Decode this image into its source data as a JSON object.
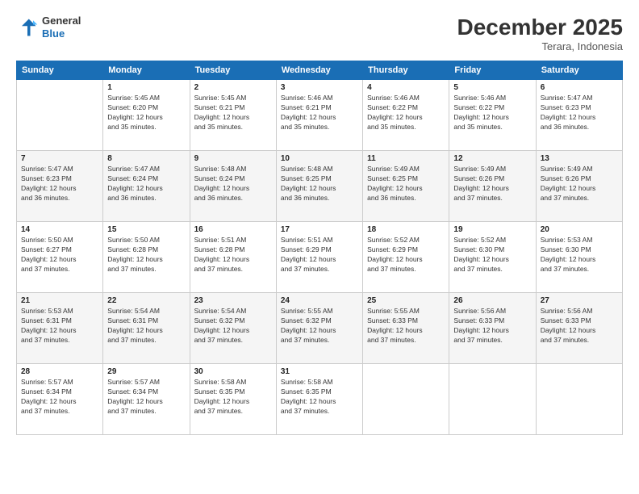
{
  "header": {
    "logo_line1": "General",
    "logo_line2": "Blue",
    "month": "December 2025",
    "location": "Terara, Indonesia"
  },
  "weekdays": [
    "Sunday",
    "Monday",
    "Tuesday",
    "Wednesday",
    "Thursday",
    "Friday",
    "Saturday"
  ],
  "weeks": [
    [
      {
        "day": "",
        "info": ""
      },
      {
        "day": "1",
        "info": "Sunrise: 5:45 AM\nSunset: 6:20 PM\nDaylight: 12 hours\nand 35 minutes."
      },
      {
        "day": "2",
        "info": "Sunrise: 5:45 AM\nSunset: 6:21 PM\nDaylight: 12 hours\nand 35 minutes."
      },
      {
        "day": "3",
        "info": "Sunrise: 5:46 AM\nSunset: 6:21 PM\nDaylight: 12 hours\nand 35 minutes."
      },
      {
        "day": "4",
        "info": "Sunrise: 5:46 AM\nSunset: 6:22 PM\nDaylight: 12 hours\nand 35 minutes."
      },
      {
        "day": "5",
        "info": "Sunrise: 5:46 AM\nSunset: 6:22 PM\nDaylight: 12 hours\nand 35 minutes."
      },
      {
        "day": "6",
        "info": "Sunrise: 5:47 AM\nSunset: 6:23 PM\nDaylight: 12 hours\nand 36 minutes."
      }
    ],
    [
      {
        "day": "7",
        "info": "Sunrise: 5:47 AM\nSunset: 6:23 PM\nDaylight: 12 hours\nand 36 minutes."
      },
      {
        "day": "8",
        "info": "Sunrise: 5:47 AM\nSunset: 6:24 PM\nDaylight: 12 hours\nand 36 minutes."
      },
      {
        "day": "9",
        "info": "Sunrise: 5:48 AM\nSunset: 6:24 PM\nDaylight: 12 hours\nand 36 minutes."
      },
      {
        "day": "10",
        "info": "Sunrise: 5:48 AM\nSunset: 6:25 PM\nDaylight: 12 hours\nand 36 minutes."
      },
      {
        "day": "11",
        "info": "Sunrise: 5:49 AM\nSunset: 6:25 PM\nDaylight: 12 hours\nand 36 minutes."
      },
      {
        "day": "12",
        "info": "Sunrise: 5:49 AM\nSunset: 6:26 PM\nDaylight: 12 hours\nand 37 minutes."
      },
      {
        "day": "13",
        "info": "Sunrise: 5:49 AM\nSunset: 6:26 PM\nDaylight: 12 hours\nand 37 minutes."
      }
    ],
    [
      {
        "day": "14",
        "info": "Sunrise: 5:50 AM\nSunset: 6:27 PM\nDaylight: 12 hours\nand 37 minutes."
      },
      {
        "day": "15",
        "info": "Sunrise: 5:50 AM\nSunset: 6:28 PM\nDaylight: 12 hours\nand 37 minutes."
      },
      {
        "day": "16",
        "info": "Sunrise: 5:51 AM\nSunset: 6:28 PM\nDaylight: 12 hours\nand 37 minutes."
      },
      {
        "day": "17",
        "info": "Sunrise: 5:51 AM\nSunset: 6:29 PM\nDaylight: 12 hours\nand 37 minutes."
      },
      {
        "day": "18",
        "info": "Sunrise: 5:52 AM\nSunset: 6:29 PM\nDaylight: 12 hours\nand 37 minutes."
      },
      {
        "day": "19",
        "info": "Sunrise: 5:52 AM\nSunset: 6:30 PM\nDaylight: 12 hours\nand 37 minutes."
      },
      {
        "day": "20",
        "info": "Sunrise: 5:53 AM\nSunset: 6:30 PM\nDaylight: 12 hours\nand 37 minutes."
      }
    ],
    [
      {
        "day": "21",
        "info": "Sunrise: 5:53 AM\nSunset: 6:31 PM\nDaylight: 12 hours\nand 37 minutes."
      },
      {
        "day": "22",
        "info": "Sunrise: 5:54 AM\nSunset: 6:31 PM\nDaylight: 12 hours\nand 37 minutes."
      },
      {
        "day": "23",
        "info": "Sunrise: 5:54 AM\nSunset: 6:32 PM\nDaylight: 12 hours\nand 37 minutes."
      },
      {
        "day": "24",
        "info": "Sunrise: 5:55 AM\nSunset: 6:32 PM\nDaylight: 12 hours\nand 37 minutes."
      },
      {
        "day": "25",
        "info": "Sunrise: 5:55 AM\nSunset: 6:33 PM\nDaylight: 12 hours\nand 37 minutes."
      },
      {
        "day": "26",
        "info": "Sunrise: 5:56 AM\nSunset: 6:33 PM\nDaylight: 12 hours\nand 37 minutes."
      },
      {
        "day": "27",
        "info": "Sunrise: 5:56 AM\nSunset: 6:33 PM\nDaylight: 12 hours\nand 37 minutes."
      }
    ],
    [
      {
        "day": "28",
        "info": "Sunrise: 5:57 AM\nSunset: 6:34 PM\nDaylight: 12 hours\nand 37 minutes."
      },
      {
        "day": "29",
        "info": "Sunrise: 5:57 AM\nSunset: 6:34 PM\nDaylight: 12 hours\nand 37 minutes."
      },
      {
        "day": "30",
        "info": "Sunrise: 5:58 AM\nSunset: 6:35 PM\nDaylight: 12 hours\nand 37 minutes."
      },
      {
        "day": "31",
        "info": "Sunrise: 5:58 AM\nSunset: 6:35 PM\nDaylight: 12 hours\nand 37 minutes."
      },
      {
        "day": "",
        "info": ""
      },
      {
        "day": "",
        "info": ""
      },
      {
        "day": "",
        "info": ""
      }
    ]
  ]
}
